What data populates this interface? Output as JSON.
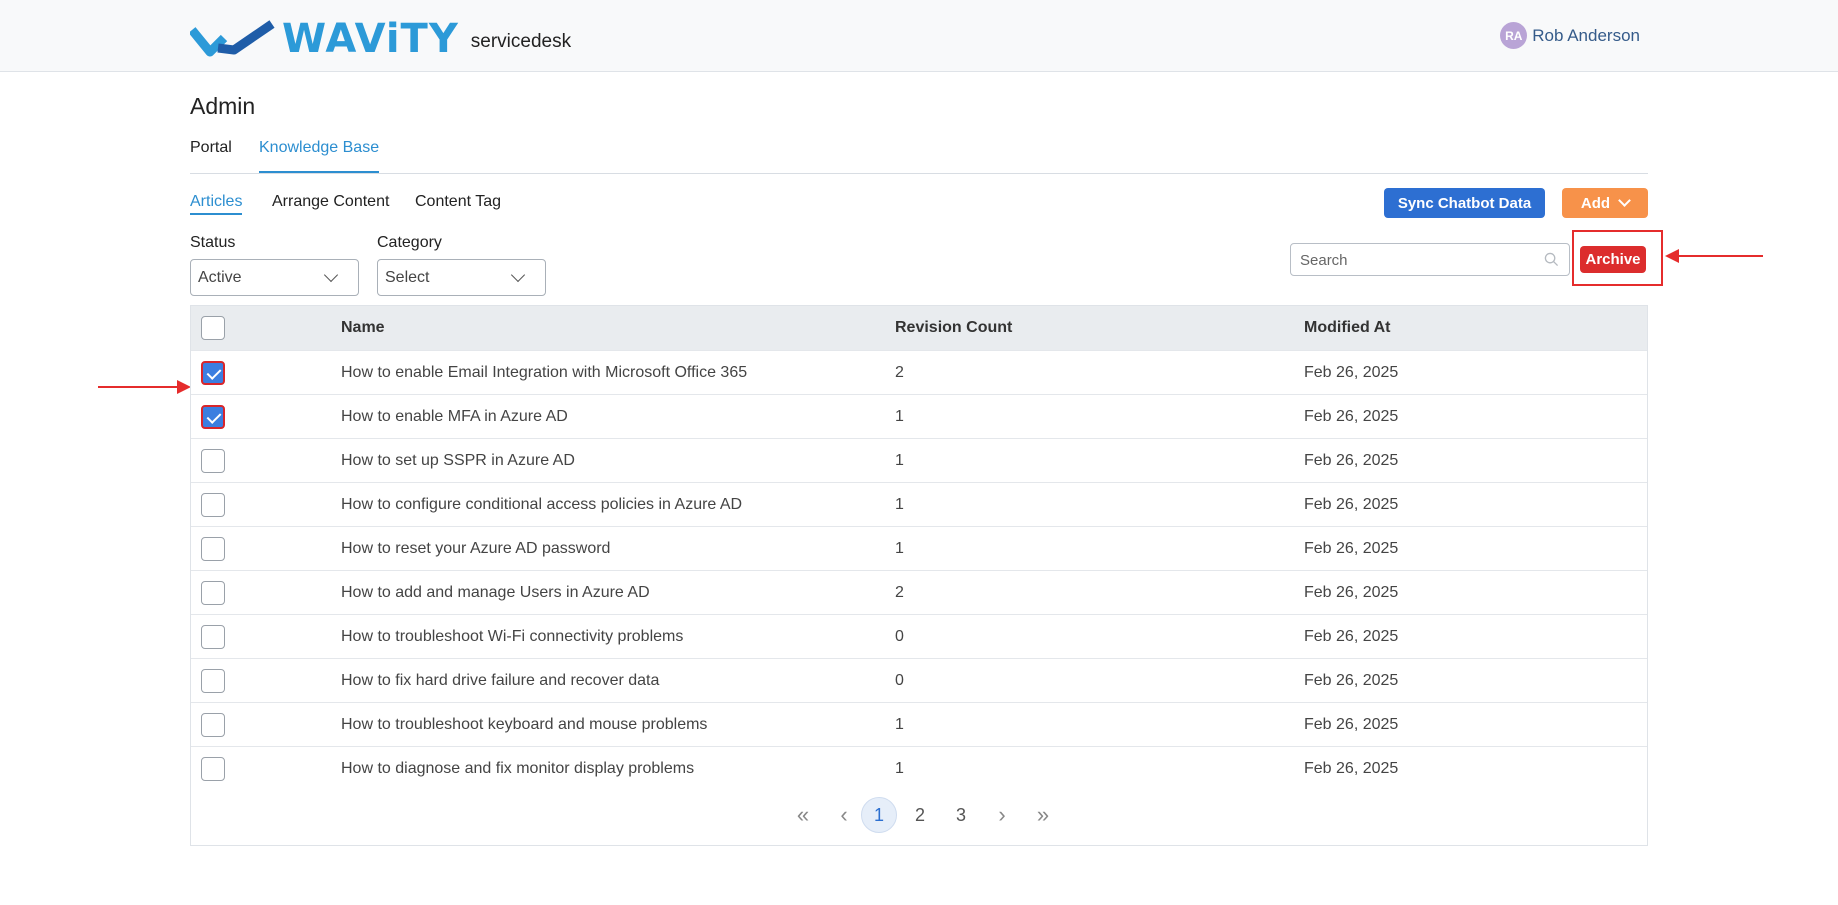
{
  "header": {
    "brand": "WAViTY",
    "product": "servicedesk",
    "user_initials": "RA",
    "user_name": "Rob Anderson"
  },
  "page": {
    "title": "Admin",
    "tabs": [
      {
        "label": "Portal",
        "active": false
      },
      {
        "label": "Knowledge Base",
        "active": true
      }
    ],
    "subtabs": [
      {
        "label": "Articles",
        "active": true
      },
      {
        "label": "Arrange Content",
        "active": false
      },
      {
        "label": "Content Tag",
        "active": false
      }
    ]
  },
  "toolbar": {
    "sync_label": "Sync Chatbot Data",
    "add_label": "Add",
    "search_placeholder": "Search",
    "archive_label": "Archive"
  },
  "filters": {
    "status_label": "Status",
    "status_value": "Active",
    "category_label": "Category",
    "category_value": "Select"
  },
  "table": {
    "headers": {
      "name": "Name",
      "revision": "Revision Count",
      "modified": "Modified At"
    },
    "rows": [
      {
        "name": "How to enable Email Integration with Microsoft Office 365",
        "revision": "2",
        "modified": "Feb 26, 2025",
        "checked": true
      },
      {
        "name": "How to enable MFA in Azure AD",
        "revision": "1",
        "modified": "Feb 26, 2025",
        "checked": true
      },
      {
        "name": "How to set up SSPR in Azure AD",
        "revision": "1",
        "modified": "Feb 26, 2025",
        "checked": false
      },
      {
        "name": "How to configure conditional access policies in Azure AD",
        "revision": "1",
        "modified": "Feb 26, 2025",
        "checked": false
      },
      {
        "name": "How to reset your Azure AD password",
        "revision": "1",
        "modified": "Feb 26, 2025",
        "checked": false
      },
      {
        "name": "How to add and manage Users in Azure AD",
        "revision": "2",
        "modified": "Feb 26, 2025",
        "checked": false
      },
      {
        "name": "How to troubleshoot Wi-Fi connectivity problems",
        "revision": "0",
        "modified": "Feb 26, 2025",
        "checked": false
      },
      {
        "name": "How to fix hard drive failure and recover data",
        "revision": "0",
        "modified": "Feb 26, 2025",
        "checked": false
      },
      {
        "name": "How to troubleshoot keyboard and mouse problems",
        "revision": "1",
        "modified": "Feb 26, 2025",
        "checked": false
      },
      {
        "name": "How to diagnose and fix monitor display problems",
        "revision": "1",
        "modified": "Feb 26, 2025",
        "checked": false
      }
    ]
  },
  "pagination": {
    "first": "«",
    "prev": "‹",
    "pages": [
      "1",
      "2",
      "3"
    ],
    "current": "1",
    "next": "›",
    "last": "»"
  },
  "colors": {
    "accent": "#2c8ed0",
    "sync": "#2d6fd2",
    "add": "#f7924a",
    "archive": "#dc2d2d",
    "annotation": "#e52c2c"
  }
}
